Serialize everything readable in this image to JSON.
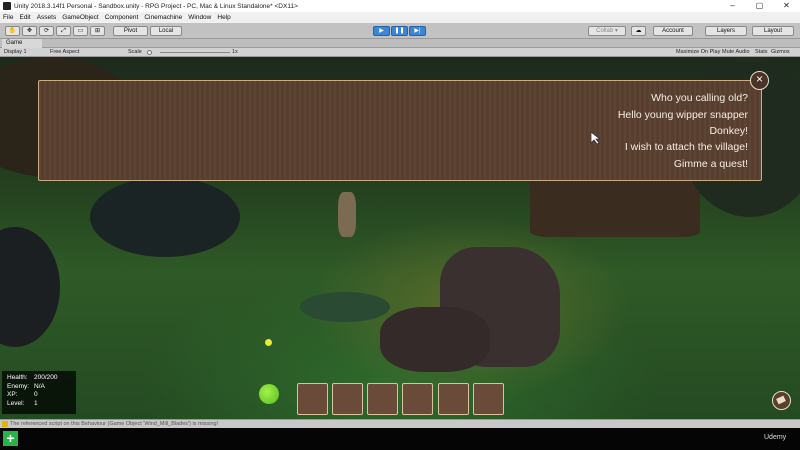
{
  "window": {
    "title": "Unity 2018.3.14f1 Personal - Sandbox.unity - RPG Project - PC, Mac & Linux Standalone* <DX11>",
    "controls": [
      "–",
      "▢",
      "✕"
    ]
  },
  "menu": [
    "File",
    "Edit",
    "Assets",
    "GameObject",
    "Component",
    "Cinemachine",
    "Window",
    "Help"
  ],
  "toolbar": {
    "pivot": "Pivot",
    "local": "Local",
    "collab": "Collab ▾",
    "account": "Account",
    "layers": "Layers",
    "layout": "Layout"
  },
  "game_tab": {
    "label": "Game"
  },
  "game_bar": {
    "display": "Display 1",
    "aspect": "Free Aspect",
    "scale_label": "Scale",
    "scale_value": "1x",
    "maximize": "Maximize On Play",
    "mute": "Mute Audio",
    "stats": "Stats",
    "gizmos": "Gizmos"
  },
  "dialogue": {
    "lines": [
      "Who you calling old?",
      "Hello young wipper snapper",
      "Donkey!",
      "I wish to attach the village!",
      "Gimme a quest!"
    ]
  },
  "stats": {
    "health_label": "Health:",
    "health_value": "200/200",
    "enemy_label": "Enemy:",
    "enemy_value": "N/A",
    "xp_label": "XP:",
    "xp_value": "0",
    "level_label": "Level:",
    "level_value": "1"
  },
  "status": {
    "message": "The referenced script on this Behaviour (Game Object 'Wind_Mill_Blades') is missing!"
  },
  "taskbar": {
    "brand": "Udemy"
  },
  "colors": {
    "panel": "#5b4030",
    "panel_border": "#c9ad85",
    "play_blue": "#3b86d6"
  }
}
